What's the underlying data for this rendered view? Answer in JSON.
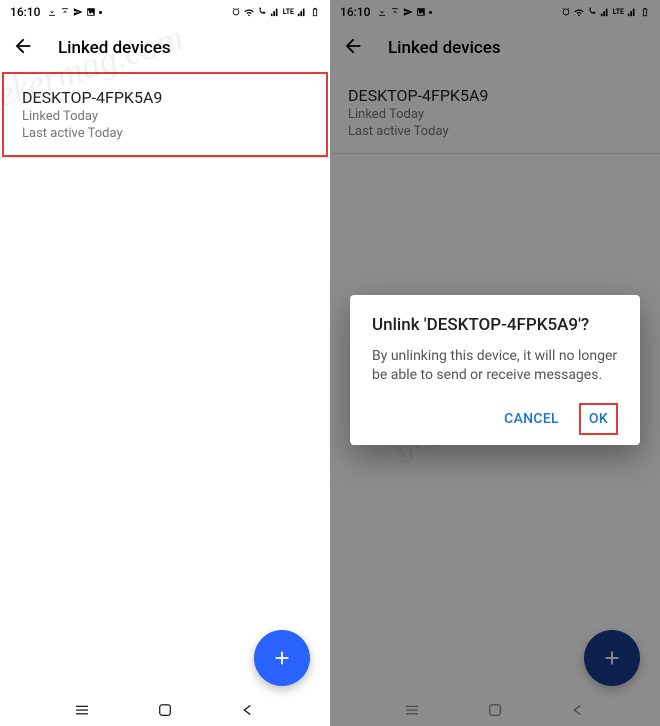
{
  "status": {
    "time": "16:10",
    "left_icons": [
      "download-icon",
      "upload-icon",
      "send-icon",
      "image-icon",
      "dot-icon"
    ],
    "right_icons": [
      "alarm-icon",
      "wifi-icon",
      "volte-icon",
      "signal-icon",
      "lte-icon",
      "signal-icon",
      "battery-icon"
    ]
  },
  "header": {
    "title": "Linked devices"
  },
  "device": {
    "name": "DESKTOP-4FPK5A9",
    "linked": "Linked Today",
    "last_active": "Last active Today"
  },
  "dialog": {
    "title": "Unlink 'DESKTOP-4FPK5A9'?",
    "body": "By unlinking this device, it will no longer be able to send or receive messages.",
    "cancel": "CANCEL",
    "ok": "OK"
  },
  "watermark": "geekermag.com"
}
